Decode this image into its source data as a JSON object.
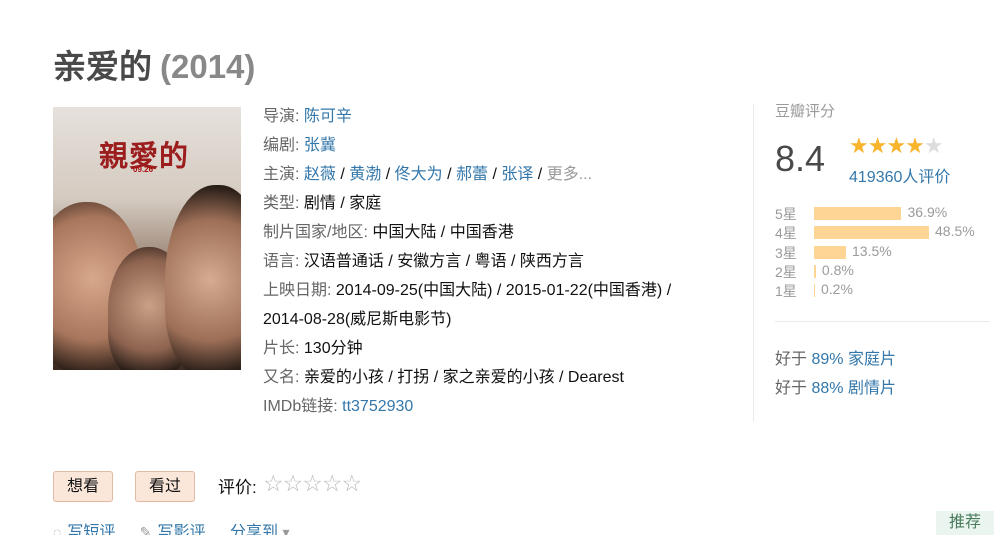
{
  "movie": {
    "title": "亲爱的",
    "year": "(2014)"
  },
  "poster": {
    "title_text": "親愛的",
    "badge_text": "09.26"
  },
  "info": {
    "director_label": "导演:",
    "director": "陈可辛",
    "writer_label": "编剧:",
    "writer": "张冀",
    "cast_label": "主演:",
    "cast": [
      "赵薇",
      "黄渤",
      "佟大为",
      "郝蕾",
      "张译"
    ],
    "cast_more": "更多...",
    "genre_label": "类型:",
    "genre": "剧情 / 家庭",
    "country_label": "制片国家/地区:",
    "country": "中国大陆 / 中国香港",
    "language_label": "语言:",
    "language": "汉语普通话 / 安徽方言 / 粤语 / 陕西方言",
    "release_label": "上映日期:",
    "release_line1": "2014-09-25(中国大陆) / 2015-01-22(中国香港) /",
    "release_line2": "2014-08-28(威尼斯电影节)",
    "runtime_label": "片长:",
    "runtime": "130分钟",
    "aka_label": "又名:",
    "aka": "亲爱的小孩 / 打拐 / 家之亲爱的小孩 / Dearest",
    "imdb_label": "IMDb链接:",
    "imdb": "tt3752930"
  },
  "rating": {
    "label": "豆瓣评分",
    "score": "8.4",
    "stars_filled": "★★★★",
    "stars_empty": "★",
    "votes": "419360人评价",
    "distribution": [
      {
        "label": "5星",
        "percent": "36.9%",
        "value": 36.9
      },
      {
        "label": "4星",
        "percent": "48.5%",
        "value": 48.5
      },
      {
        "label": "3星",
        "percent": "13.5%",
        "value": 13.5
      },
      {
        "label": "2星",
        "percent": "0.8%",
        "value": 0.8
      },
      {
        "label": "1星",
        "percent": "0.2%",
        "value": 0.2
      }
    ],
    "better_than": [
      {
        "prefix": "好于",
        "percent": "89%",
        "genre": "家庭片"
      },
      {
        "prefix": "好于",
        "percent": "88%",
        "genre": "剧情片"
      }
    ]
  },
  "actions": {
    "want_label": "想看",
    "seen_label": "看过",
    "rate_label": "评价:",
    "rate_stars": "☆☆☆☆☆",
    "write_short": "写短评",
    "write_review": "写影评",
    "share": "分享到",
    "recommend": "推荐"
  }
}
